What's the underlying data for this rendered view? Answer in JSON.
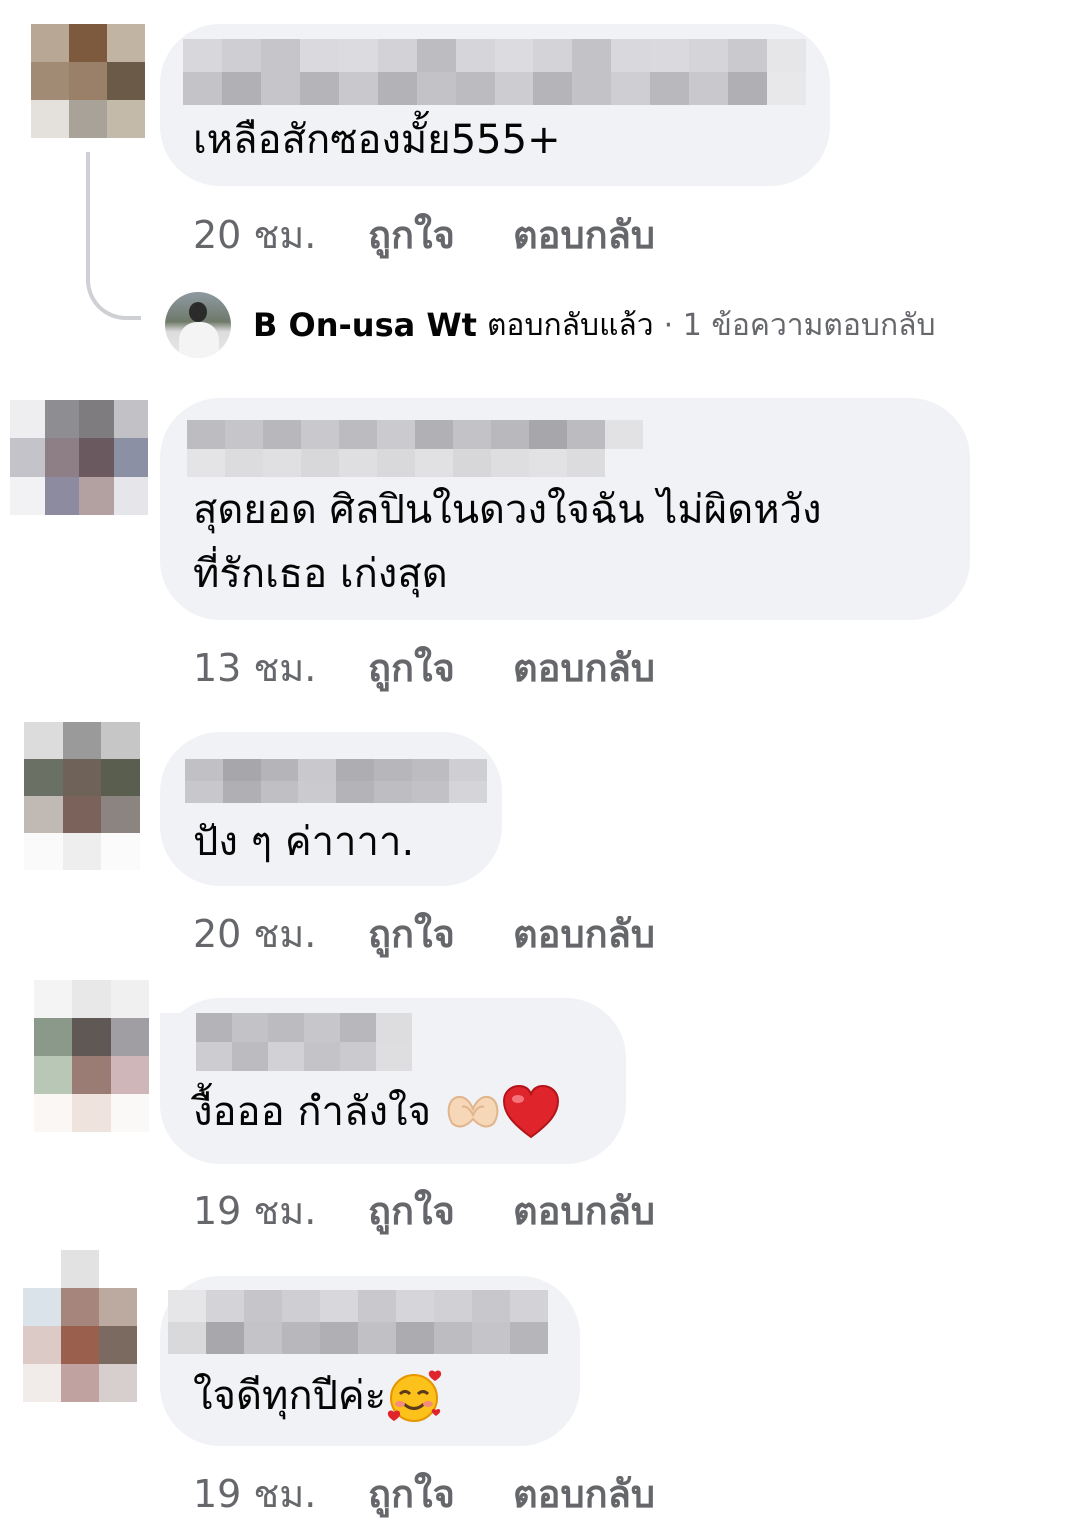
{
  "comments": [
    {
      "text": "เหลือสักซองมั้ย555+",
      "time": "20 ชม.",
      "like": "ถูกใจ",
      "reply": "ตอบกลับ"
    },
    {
      "text_line1": "สุดยอด ศิลปินในดวงใจฉัน ไม่ผิดหวัง",
      "text_line2": "ที่รักเธอ เก่งสุด",
      "time": "13 ชม.",
      "like": "ถูกใจ",
      "reply": "ตอบกลับ"
    },
    {
      "text": "ปัง ๆ ค่าาาา.",
      "time": "20 ชม.",
      "like": "ถูกใจ",
      "reply": "ตอบกลับ"
    },
    {
      "text": "งื้อออ กำลังใจ",
      "emoji": [
        "heart-hands-emoji",
        "red-heart-emoji"
      ],
      "time": "19 ชม.",
      "like": "ถูกใจ",
      "reply": "ตอบกลับ"
    },
    {
      "text": "ใจดีทุกปีค่ะ",
      "emoji": [
        "smiling-face-with-hearts-emoji"
      ],
      "time": "19 ชม.",
      "like": "ถูกใจ",
      "reply": "ตอบกลับ"
    }
  ],
  "thread_reply": {
    "name": "B On-usa Wt",
    "action": "ตอบกลับแล้ว",
    "count": "· 1 ข้อความตอบกลับ"
  },
  "colors": {
    "bubble": "#f0f2f5",
    "meta_text": "#65676b",
    "body_text": "#050505",
    "thread_line": "#ced0d4"
  }
}
